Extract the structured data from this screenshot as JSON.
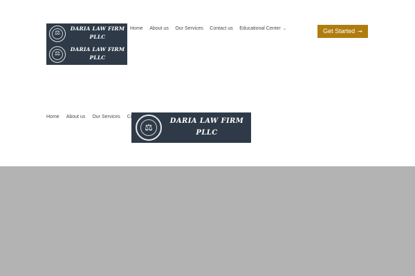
{
  "logo": {
    "line1": "DARIA LAW FIRM",
    "line2": "PLLC",
    "icon": "scales-of-justice-icon"
  },
  "main_nav": {
    "items": [
      {
        "label": "Home"
      },
      {
        "label": "About us"
      },
      {
        "label": "Our Services"
      },
      {
        "label": "Contact us"
      },
      {
        "label": "Educational Center",
        "has_dropdown": true
      }
    ]
  },
  "cta": {
    "label": "Get Started",
    "arrow": "→",
    "color": "#b07c0e"
  },
  "sticky_nav": {
    "items": [
      {
        "label": "Home"
      },
      {
        "label": "About us"
      },
      {
        "label": "Our Services"
      },
      {
        "label": "Co"
      }
    ]
  },
  "colors": {
    "logo_background": "#2e3a47",
    "page_background": "#ffffff",
    "gray_area": "#b3b3b3"
  }
}
